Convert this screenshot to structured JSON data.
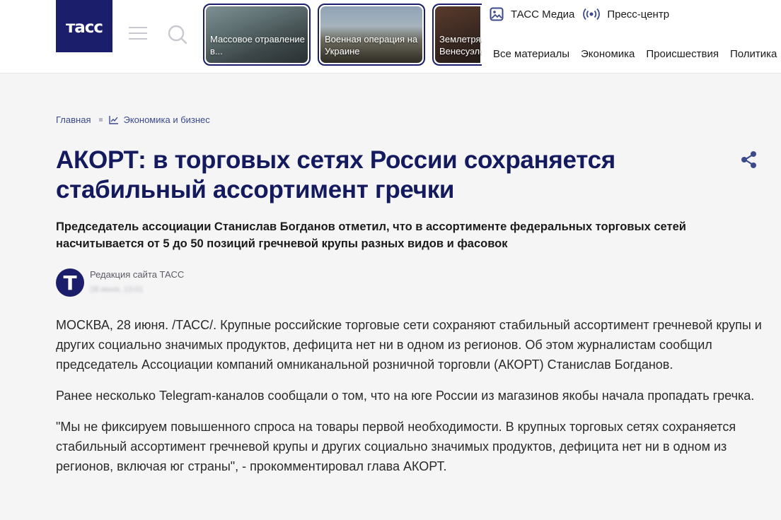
{
  "header": {
    "logo_text": "тасс",
    "stories": [
      {
        "caption": "Массовое отравление в..."
      },
      {
        "caption": "Военная операция на Украине"
      },
      {
        "caption": "Землетрясение Венесуэле"
      }
    ],
    "top_links": [
      {
        "label": "ТАСС Медиа",
        "icon": "image-icon"
      },
      {
        "label": "Пресс-центр",
        "icon": "broadcast-icon"
      }
    ],
    "nav": [
      "Все материалы",
      "Экономика",
      "Происшествия",
      "Политика"
    ]
  },
  "breadcrumb": {
    "home": "Главная",
    "section": "Экономика и бизнес"
  },
  "article": {
    "title": "АКОРТ: в торговых сетях России сохраняется стабильный ассортимент гречки",
    "lead": "Председатель ассоциации Станислав Богданов отметил, что в ассортименте федеральных торговых сетей насчитывается от 5 до 50 позиций гречневой крупы разных видов и фасовок",
    "author": "Редакция сайта ТАСС",
    "avatar_letter": "Т",
    "date": "28 июня, 13:01",
    "paragraphs": [
      "МОСКВА, 28 июня. /ТАСС/. Крупные российские торговые сети сохраняют стабильный ассортимент гречневой крупы и других социально значимых продуктов, дефицита нет ни в одном из регионов. Об этом журналистам сообщил председатель Ассоциации компаний омниканальной розничной торговли (АКОРТ) Станислав Богданов.",
      "Ранее несколько Telegram-каналов сообщали о том, что на юге России из магазинов якобы начала пропадать гречка.",
      "\"Мы не фиксируем повышенного спроса на товары первой необходимости. В крупных торговых сетях сохраняется стабильный ассортимент гречневой крупы и других социально значимых продуктов, дефицита нет ни в одном из регионов, включая юг страны\", - прокомментировал глава АКОРТ."
    ]
  },
  "colors": {
    "brand": "#1b1f6b",
    "title": "#141a5e",
    "link": "#3b4a8c",
    "background": "#f5f5f6"
  }
}
